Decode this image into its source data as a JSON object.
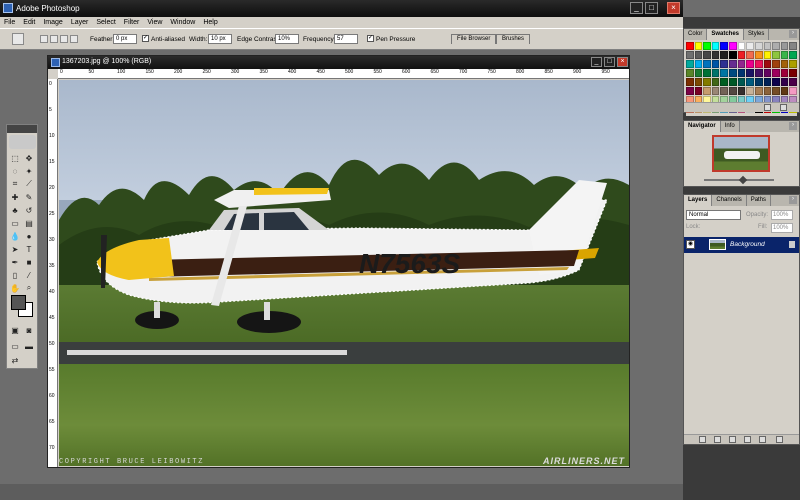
{
  "app": {
    "title": "Adobe Photoshop"
  },
  "window_buttons": {
    "minimize": "_",
    "restore": "□",
    "close": "×"
  },
  "menu": [
    "File",
    "Edit",
    "Image",
    "Layer",
    "Select",
    "Filter",
    "View",
    "Window",
    "Help"
  ],
  "options": {
    "feather_label": "Feather:",
    "feather_value": "0 px",
    "antialiased_label": "Anti-aliased",
    "width_label": "Width:",
    "width_value": "10 px",
    "edge_contrast_label": "Edge Contrast:",
    "edge_contrast_value": "10%",
    "frequency_label": "Frequency:",
    "frequency_value": "57",
    "pen_pressure_label": "Pen Pressure",
    "file_browser_tab": "File Browser",
    "brushes_tab": "Brushes"
  },
  "document": {
    "title": "1367203.jpg @ 100% (RGB)",
    "ruler_ticks": [
      "0",
      "50",
      "100",
      "150",
      "200",
      "250",
      "300",
      "350",
      "400",
      "450",
      "500",
      "550",
      "600",
      "650",
      "700",
      "750",
      "800",
      "850",
      "900",
      "950"
    ],
    "vruler_ticks": [
      "0",
      "5",
      "10",
      "15",
      "20",
      "25",
      "30",
      "35",
      "40",
      "45",
      "50",
      "55",
      "60",
      "65",
      "70"
    ],
    "registration": "N7563S",
    "copyright": "COPYRIGHT BRUCE LEIBOWITZ",
    "site_watermark": "AIRLINERS.NET"
  },
  "panels": {
    "swatches": {
      "tabs": [
        "Color",
        "Swatches",
        "Styles"
      ],
      "active": "Swatches"
    },
    "navigator": {
      "tabs": [
        "Navigator",
        "Info"
      ],
      "active": "Navigator"
    },
    "layers": {
      "tabs": [
        "Layers",
        "Channels",
        "Paths"
      ],
      "active": "Layers",
      "blend_mode": "Normal",
      "opacity_label": "Opacity:",
      "opacity_value": "100%",
      "lock_label": "Lock:",
      "fill_label": "Fill:",
      "fill_value": "100%",
      "layer_name": "Background"
    }
  },
  "colors": {
    "swatches": [
      "#ff0000",
      "#ffff00",
      "#00ff00",
      "#00ffff",
      "#0000ff",
      "#ff00ff",
      "#ffffff",
      "#ebebeb",
      "#d6d6d6",
      "#c2c2c2",
      "#adadad",
      "#999999",
      "#858585",
      "#707070",
      "#5c5c5c",
      "#474747",
      "#333333",
      "#1f1f1f",
      "#000000",
      "#ee1d24",
      "#f26c4f",
      "#f7941d",
      "#fff200",
      "#8dc63f",
      "#39b54a",
      "#00a651",
      "#00a99d",
      "#00aeef",
      "#0072bc",
      "#0054a6",
      "#2e3192",
      "#662d91",
      "#92278f",
      "#ec008c",
      "#ed145b",
      "#9e0b0f",
      "#a0410d",
      "#a3620a",
      "#aba000",
      "#598527",
      "#1a7b30",
      "#007236",
      "#00746b",
      "#0076a3",
      "#004a80",
      "#003471",
      "#1b1464",
      "#440e62",
      "#630460",
      "#9e005d",
      "#9e0039",
      "#790000",
      "#7b2e00",
      "#7d4900",
      "#827b00",
      "#406618",
      "#005e20",
      "#005826",
      "#005952",
      "#005b7f",
      "#003663",
      "#002157",
      "#0d004c",
      "#32004b",
      "#4b0049",
      "#7b0046",
      "#7a0026",
      "#c69c6d",
      "#998675",
      "#736357",
      "#534741",
      "#362f2d",
      "#c7b299",
      "#a67c52",
      "#8c6239",
      "#754c24",
      "#603913",
      "#f49ac2",
      "#f69679",
      "#fbaf5d",
      "#fff799",
      "#c4df9b",
      "#a3d39c",
      "#82ca9c",
      "#7accc8",
      "#6dcff6",
      "#7da7d9",
      "#8393ca",
      "#8781bd",
      "#a186be",
      "#bd8cbf",
      "#f7977a",
      "#fdc68a",
      "#fff79a",
      "#a2d39c",
      "#6ecff6",
      "#8882be",
      "#f06eaa",
      "#ffffff",
      "#000000",
      "#ff0000",
      "#00ff00",
      "#0000ff",
      "#ffff00",
      "#ff8000",
      "#8000ff",
      "#00ff80",
      "#ff0080",
      "#808080",
      "#404040",
      "#c0c0c0",
      "#800000",
      "#008000",
      "#000080",
      "#808000",
      "#800080",
      "#008080",
      "#ffcc99",
      "#cc9966",
      "#996633",
      "#663300",
      "#ccffcc",
      "#99cc99",
      "#669966"
    ]
  }
}
